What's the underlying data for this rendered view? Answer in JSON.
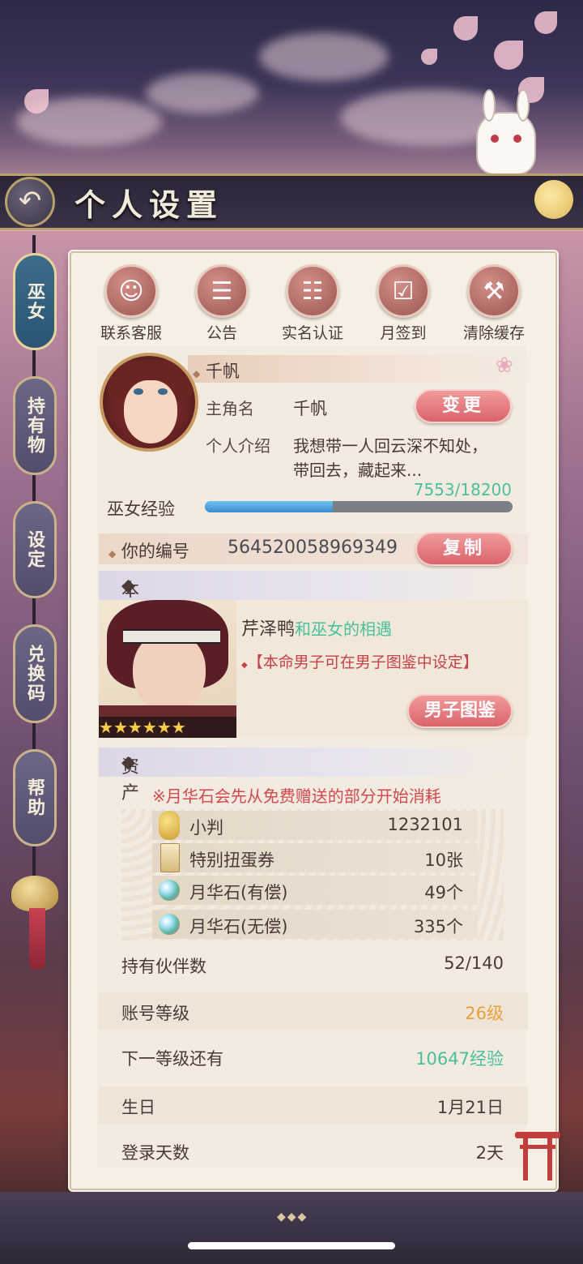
{
  "header": {
    "title": "个人设置",
    "back_icon": "back-arrow-icon"
  },
  "side_nav": [
    {
      "label": "巫女",
      "active": true
    },
    {
      "label": "持有物",
      "active": false
    },
    {
      "label": "设定",
      "active": false
    },
    {
      "label": "兑换码",
      "active": false
    },
    {
      "label": "帮助",
      "active": false
    }
  ],
  "quick_actions": [
    {
      "label": "联系客服",
      "icon": "customer-service-icon"
    },
    {
      "label": "公告",
      "icon": "notice-icon"
    },
    {
      "label": "实名认证",
      "icon": "id-verify-icon"
    },
    {
      "label": "月签到",
      "icon": "calendar-check-icon"
    },
    {
      "label": "清除缓存",
      "icon": "broom-icon"
    }
  ],
  "profile": {
    "display_name": "千帆",
    "protagonist_label": "主角名",
    "protagonist_name": "千帆",
    "change_button": "变更",
    "intro_label": "个人介绍",
    "intro_line1": "我想带一人回云深不知处，",
    "intro_line2": "带回去，藏起来...",
    "exp_label": "巫女经验",
    "exp_text": "7553/18200",
    "exp_current": 7553,
    "exp_max": 18200
  },
  "id_row": {
    "label": "你的编号",
    "value": "564520058969349",
    "copy_button": "复制"
  },
  "destined": {
    "section_title": "本命男子",
    "name": "芹泽鸭",
    "relation": "和巫女的相遇",
    "hint": "【本命男子可在男子图鉴中设定】",
    "button": "男子图鉴",
    "stars": 6
  },
  "assets": {
    "section_title": "资产",
    "notice": "※月华石会先从免费赠送的部分开始消耗",
    "items": [
      {
        "name": "小判",
        "value": "1232101",
        "icon": "gold-coin-icon"
      },
      {
        "name": "特别扭蛋券",
        "value": "10张",
        "icon": "gacha-ticket-icon"
      },
      {
        "name": "月华石(有偿)",
        "value": "49个",
        "icon": "moon-stone-icon"
      },
      {
        "name": "月华石(无偿)",
        "value": "335个",
        "icon": "moon-stone-icon"
      }
    ]
  },
  "stats": [
    {
      "label": "持有伙伴数",
      "value": "52/140",
      "color": "#4a3a36"
    },
    {
      "label": "账号等级",
      "value": "26级",
      "color": "#e8a03a"
    },
    {
      "label": "下一等级还有",
      "value": "10647经验",
      "color": "#4bbf9c"
    },
    {
      "label": "生日",
      "value": "1月21日",
      "color": "#4a3a36"
    },
    {
      "label": "登录天数",
      "value": "2天",
      "color": "#4a3a36"
    }
  ],
  "colors": {
    "accent_pink": "#d9636b",
    "teal": "#4bbf9c",
    "orange": "#e8a03a",
    "notice_red": "#d2484f",
    "hint_red": "#c8404a"
  }
}
